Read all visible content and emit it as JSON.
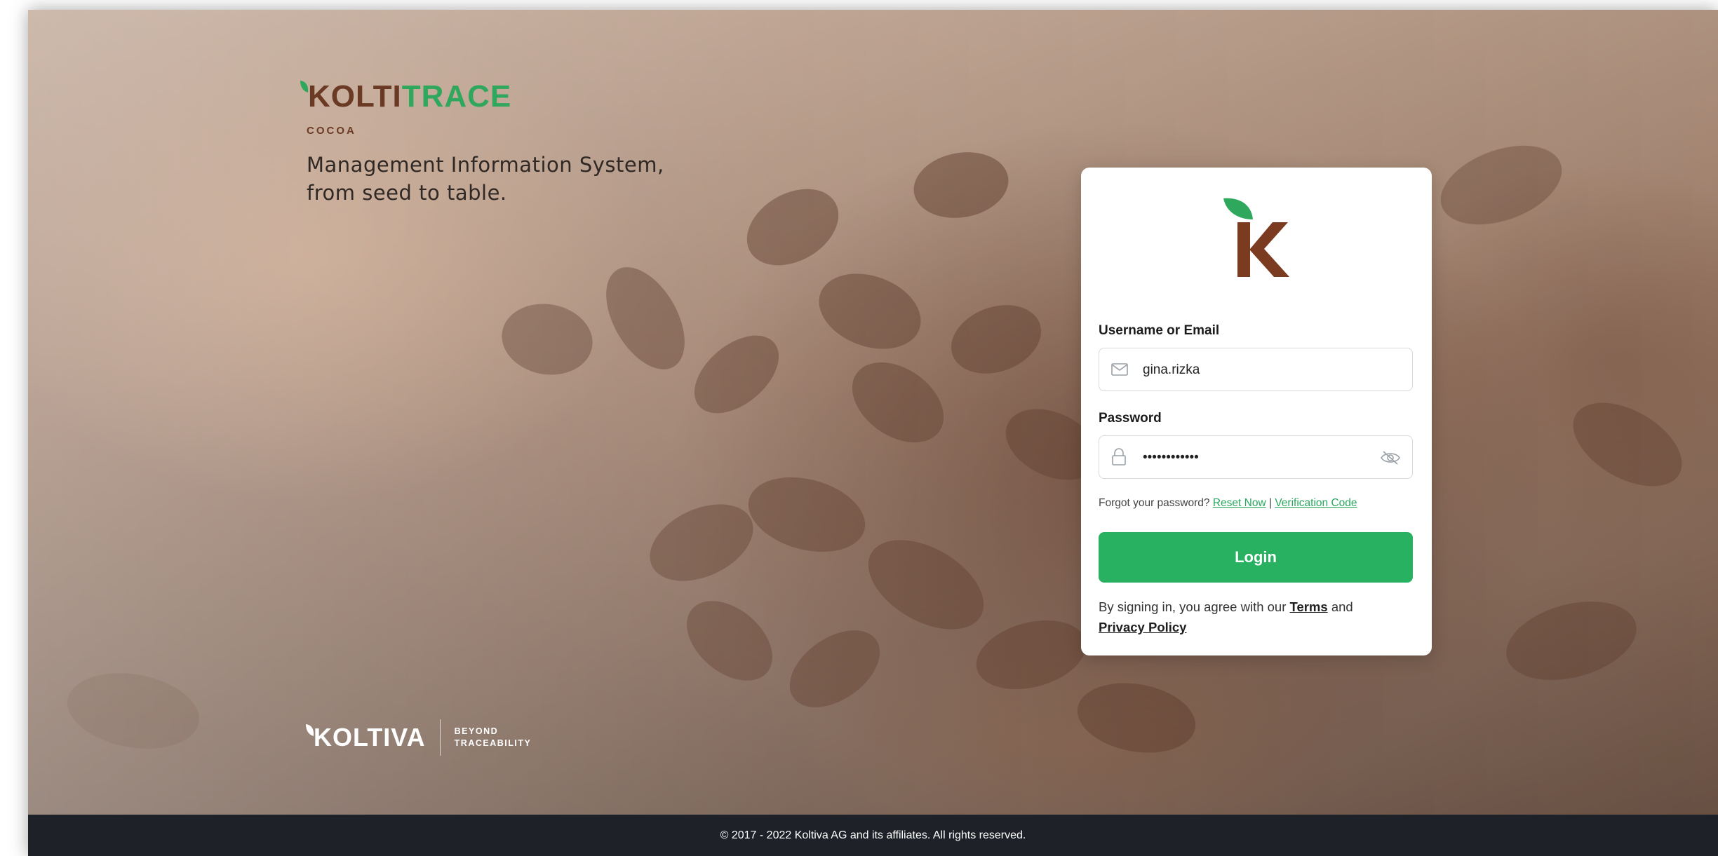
{
  "brand": {
    "logo_part1": "KOLTI",
    "logo_part2": "TRACE",
    "product": "COCOA",
    "tagline": "Management Information System, from seed to table."
  },
  "login": {
    "logo_icon": "koltiva-k-leaf-icon",
    "username_label": "Username or Email",
    "username_value": "gina.rizka",
    "username_icon": "mail-icon",
    "password_label": "Password",
    "password_value": "••••••••••••",
    "password_icon": "lock-icon",
    "password_toggle_icon": "eye-off-icon",
    "forgot_text": "Forgot your password?",
    "reset_link": "Reset Now",
    "separator": "|",
    "verification_link": "Verification Code",
    "login_button": "Login",
    "agree_text": "By signing in, you agree with our",
    "terms_link": "Terms",
    "and_text": "and",
    "privacy_link": "Privacy Policy"
  },
  "partner": {
    "logo_text": "KOLTIVA",
    "tag_line1": "BEYOND",
    "tag_line2": "TRACEABILITY"
  },
  "footer": {
    "copyright": "© 2017 - 2022 Koltiva AG and its affiliates. All rights reserved."
  },
  "colors": {
    "brand_green": "#27b160",
    "brand_brown": "#6b3a24",
    "footer_bg": "#1f2128"
  }
}
